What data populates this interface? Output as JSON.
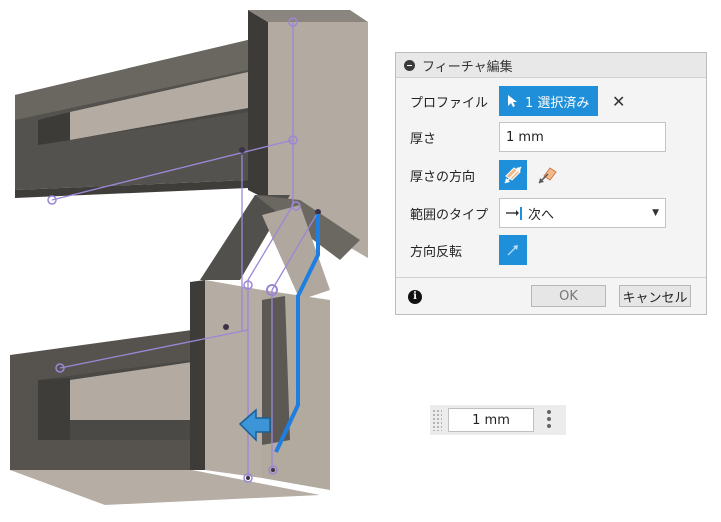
{
  "dialog": {
    "title": "フィーチャ編集",
    "profile": {
      "label": "プロファイル",
      "selection": "1 選択済み"
    },
    "thickness": {
      "label": "厚さ",
      "value": "1 mm"
    },
    "thickness_direction": {
      "label": "厚さの方向"
    },
    "extent_type": {
      "label": "範囲のタイプ",
      "value": "次へ"
    },
    "flip_direction": {
      "label": "方向反転"
    },
    "ok_label": "OK",
    "cancel_label": "キャンセル"
  },
  "float_input": {
    "value": "1 mm"
  },
  "colors": {
    "accent": "#1e8fd8",
    "sketch_line": "#9b87d6",
    "model_face": "#b5ada4",
    "model_shadow": "#4e4c48"
  },
  "icons": [
    "minus-circle-icon",
    "cursor-arrow-icon",
    "close-icon",
    "symmetric-thickness-icon",
    "one-side-thickness-icon",
    "extent-next-icon",
    "chevron-down-icon",
    "flip-arrow-icon",
    "info-icon",
    "grip-icon",
    "more-vertical-icon",
    "direction-arrow-icon"
  ]
}
